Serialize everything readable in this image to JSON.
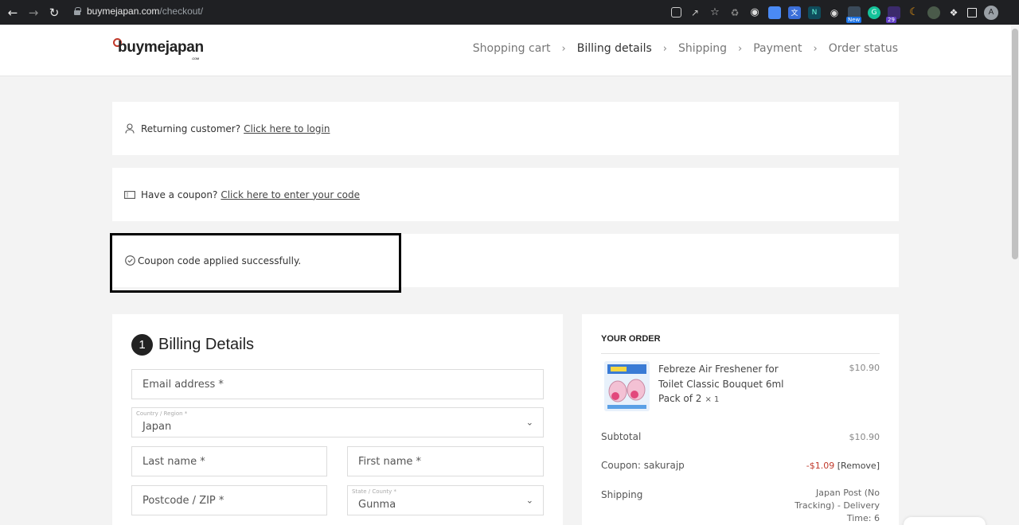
{
  "browser": {
    "url_host": "buymejapan.com",
    "url_path": "/checkout/",
    "profile_initial": "A",
    "ext_badge_new": "New",
    "ext_badge_count": "29"
  },
  "site": {
    "logo_text": "buymejapan",
    "logo_sub": ".COM",
    "steps": [
      "Shopping cart",
      "Billing details",
      "Shipping",
      "Payment",
      "Order status"
    ],
    "active_step": "Billing details"
  },
  "notices": {
    "returning_text": "Returning customer?",
    "returning_link": "Click here to login",
    "coupon_text": "Have a coupon?",
    "coupon_link": "Click here to enter your code",
    "success_text": "Coupon code applied successfully."
  },
  "billing": {
    "step_number": "1",
    "title": "Billing Details",
    "email_label": "Email address *",
    "country_small_label": "Country / Region *",
    "country_value": "Japan",
    "last_name_label": "Last name *",
    "first_name_label": "First name *",
    "postcode_label": "Postcode / ZIP *",
    "state_small_label": "State / County *",
    "state_value": "Gunma"
  },
  "order": {
    "title": "YOUR ORDER",
    "product_name": "Febreze Air Freshener for Toilet Classic Bouquet 6ml Pack of 2",
    "product_qty": "× 1",
    "product_price": "$10.90",
    "subtotal_label": "Subtotal",
    "subtotal_value": "$10.90",
    "coupon_label": "Coupon: sakurajp",
    "coupon_value": "-$1.09",
    "coupon_remove": "[Remove]",
    "shipping_label": "Shipping",
    "shipping_value": "Japan Post (No Tracking) - Delivery Time: 6"
  },
  "colors": {
    "accent_red": "#c0392b",
    "chrome_bg": "#1f2023",
    "page_bg": "#f3f3f3"
  }
}
